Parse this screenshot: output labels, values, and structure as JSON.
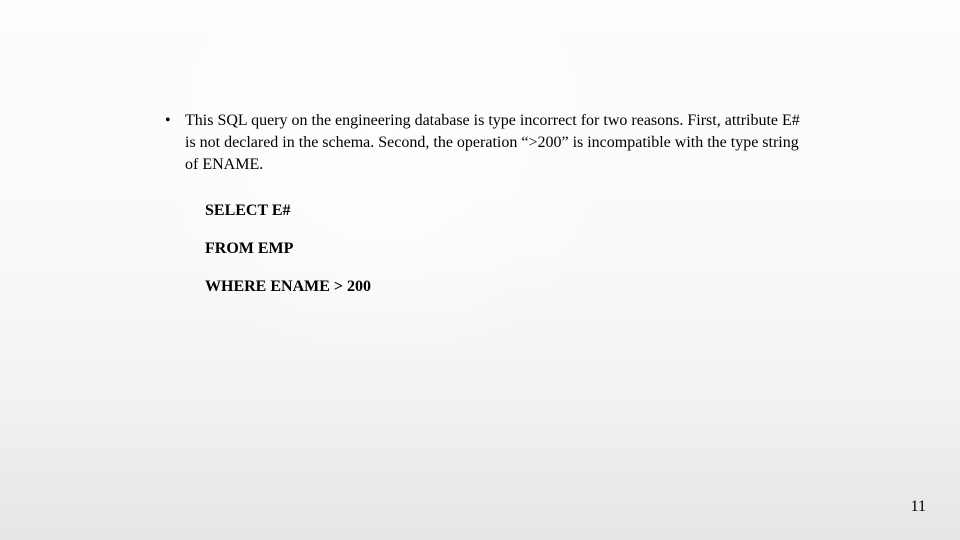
{
  "bullet": {
    "mark": "•",
    "text": "This SQL query on the engineering database is type incorrect for two reasons. First, attribute E# is not declared in the schema. Second, the operation “>200” is incompatible with the type string of ENAME."
  },
  "sql": {
    "line1": "SELECT E#",
    "line2": "FROM EMP",
    "line3": "WHERE ENAME > 200"
  },
  "page_number": "11"
}
